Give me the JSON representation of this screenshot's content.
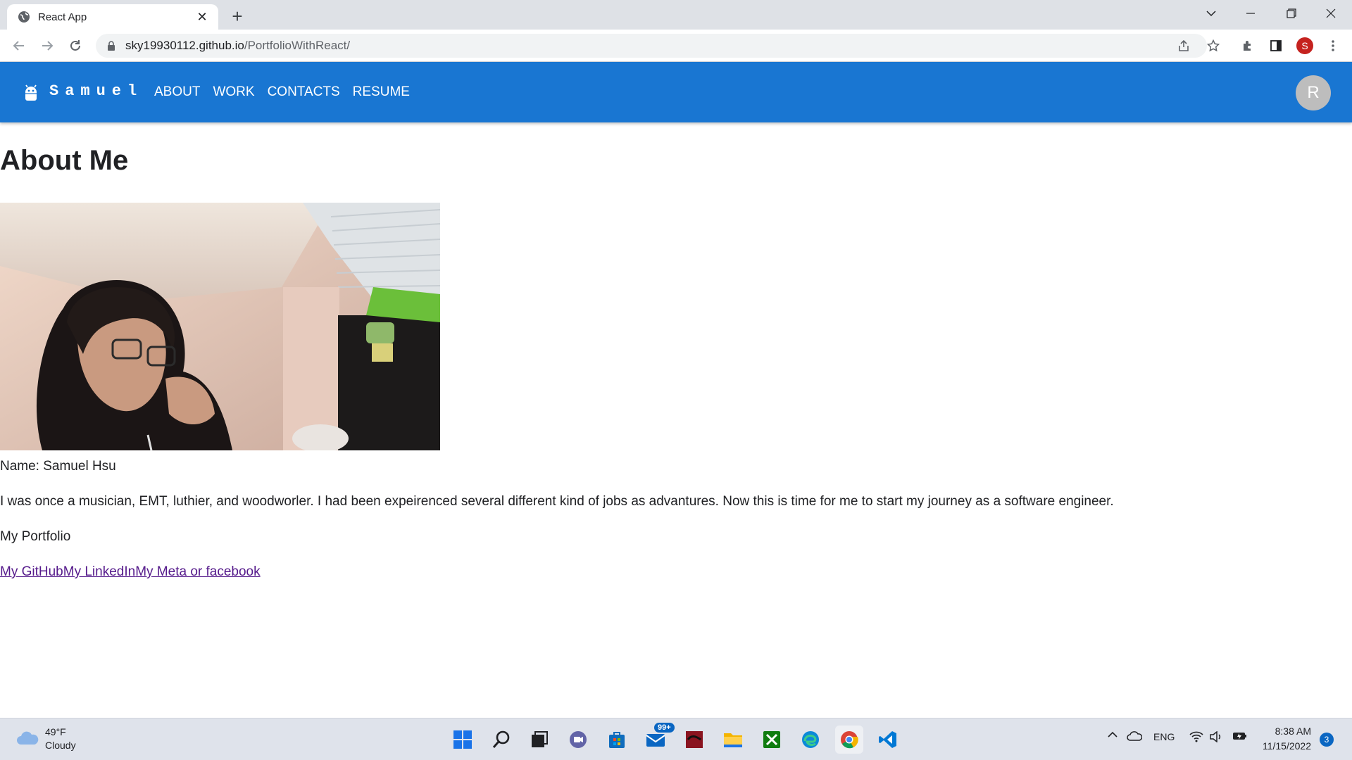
{
  "browser": {
    "tab_title": "React App",
    "url_host": "sky19930112.github.io",
    "url_path": "/PortfolioWithReact/",
    "profile_initial": "S"
  },
  "page": {
    "brand": "Samuel",
    "nav": [
      "ABOUT",
      "WORK",
      "CONTACTS",
      "RESUME"
    ],
    "avatar_initial": "R",
    "heading": "About Me",
    "name_line": "Name: Samuel Hsu",
    "bio": "I was once a musician, EMT, luthier, and woodworler. I had been expeirenced several different kind of jobs as advantures. Now this is time for me to start my journey as a software engineer.",
    "portfolio_label": "My Portfolio",
    "links": [
      "My GitHub",
      "My LinkedIn",
      "My Meta or facebook"
    ],
    "accent_color": "#1976d2",
    "link_color": "#551a8b"
  },
  "taskbar": {
    "weather_temp": "49°F",
    "weather_desc": "Cloudy",
    "mail_badge": "99+",
    "lang": "ENG",
    "time": "8:38 AM",
    "date": "11/15/2022",
    "notifications": "3"
  }
}
